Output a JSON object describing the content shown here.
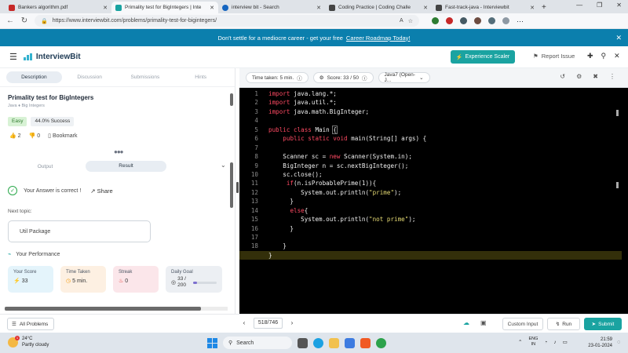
{
  "browser": {
    "tabs": [
      {
        "label": "Bankers algorithm.pdf",
        "favicon": "pdf-icon",
        "color": "#c62828",
        "active": false
      },
      {
        "label": "Primality test for BigIntegers | Inte",
        "favicon": "interviewbit-icon",
        "color": "#1aa3a1",
        "active": true
      },
      {
        "label": "interview bit - Search",
        "favicon": "search-icon",
        "color": "#1565c0",
        "active": false
      },
      {
        "label": "Coding Practice | Coding Challe",
        "favicon": "coding-icon",
        "color": "#444444",
        "active": false
      },
      {
        "label": "Fast-track-java - Interviewbit",
        "favicon": "coding-icon",
        "color": "#444444",
        "active": false
      }
    ],
    "url": "https://www.interviewbit.com/problems/primality-test-for-bigintegers/"
  },
  "banner": {
    "text": "Don't settle for a mediocre career - get your free",
    "link": "Career Roadmap Today!"
  },
  "header": {
    "logo": "InterviewBit",
    "experience_btn": "Experience Scaler",
    "report": "Report Issue"
  },
  "left": {
    "tabs": [
      "Description",
      "Discussion",
      "Submissions",
      "Hints"
    ],
    "title": "Primality test for BigIntegers",
    "breadcrumb": "Java ♦ Big Integers",
    "difficulty": "Easy",
    "success": "44.0% Success",
    "likes": "2",
    "dislikes": "0",
    "bookmark": "Bookmark",
    "result_tabs": [
      "Output",
      "Result"
    ],
    "answer": "Your Answer is correct !",
    "share": "Share",
    "next_topic_label": "Next topic:",
    "next_topic": "Util Package",
    "performance": "Your Performance",
    "cards": [
      {
        "label": "Your Score",
        "value": "33"
      },
      {
        "label": "Time Taken",
        "value": "5 min."
      },
      {
        "label": "Streak",
        "value": "0"
      },
      {
        "label": "Daily Goal",
        "value": "33 / 200",
        "progress": 0.165
      }
    ]
  },
  "editor": {
    "time": "Time taken: 5 min.",
    "score": "Score:  33  /  50",
    "language": "Java7 (Open-J..."
  },
  "bottom": {
    "all_problems": "All Problems",
    "page": "518/746",
    "custom_input": "Custom Input",
    "run": "Run",
    "submit": "Submit"
  },
  "taskbar": {
    "temp": "24°C",
    "weather": "Partly cloudy",
    "search": "Search",
    "lang_top": "ENG",
    "lang_bottom": "IN",
    "time": "21:59",
    "date": "23-01-2024"
  }
}
